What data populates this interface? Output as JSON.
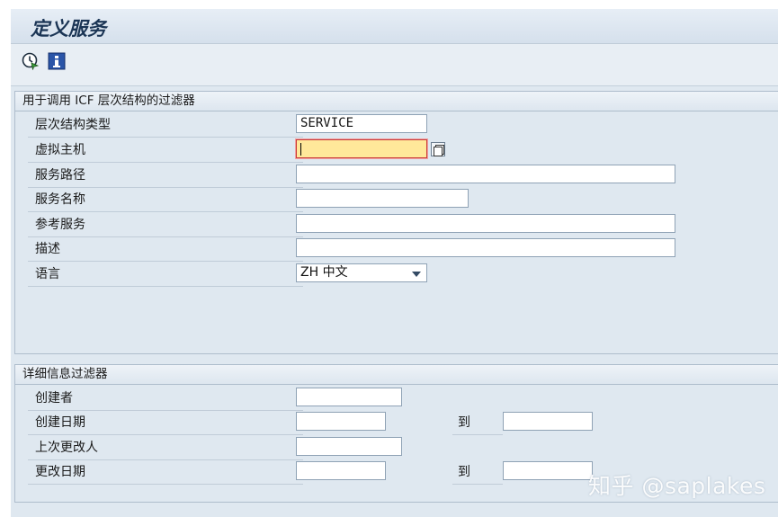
{
  "window": {
    "title": "定义服务"
  },
  "toolbar": {
    "execute_icon": "execute-clock-icon",
    "info_icon": "info-icon"
  },
  "filter_group": {
    "title": "用于调用 ICF 层次结构的过滤器",
    "fields": {
      "hierarchy_type": {
        "label": "层次结构类型",
        "value": "SERVICE"
      },
      "virtual_host": {
        "label": "虚拟主机",
        "value": ""
      },
      "service_path": {
        "label": "服务路径",
        "value": ""
      },
      "service_name": {
        "label": "服务名称",
        "value": ""
      },
      "reference_service": {
        "label": "参考服务",
        "value": ""
      },
      "description": {
        "label": "描述",
        "value": ""
      },
      "language": {
        "label": "语言",
        "value": "ZH 中文"
      }
    }
  },
  "detail_group": {
    "title": "详细信息过滤器",
    "fields": {
      "created_by": {
        "label": "创建者",
        "value": ""
      },
      "created_on": {
        "label": "创建日期",
        "value": "",
        "to_label": "到",
        "to_value": ""
      },
      "last_changed_by": {
        "label": "上次更改人",
        "value": ""
      },
      "changed_on": {
        "label": "更改日期",
        "value": "",
        "to_label": "到",
        "to_value": ""
      }
    }
  },
  "watermark": "知乎 @saplakes"
}
